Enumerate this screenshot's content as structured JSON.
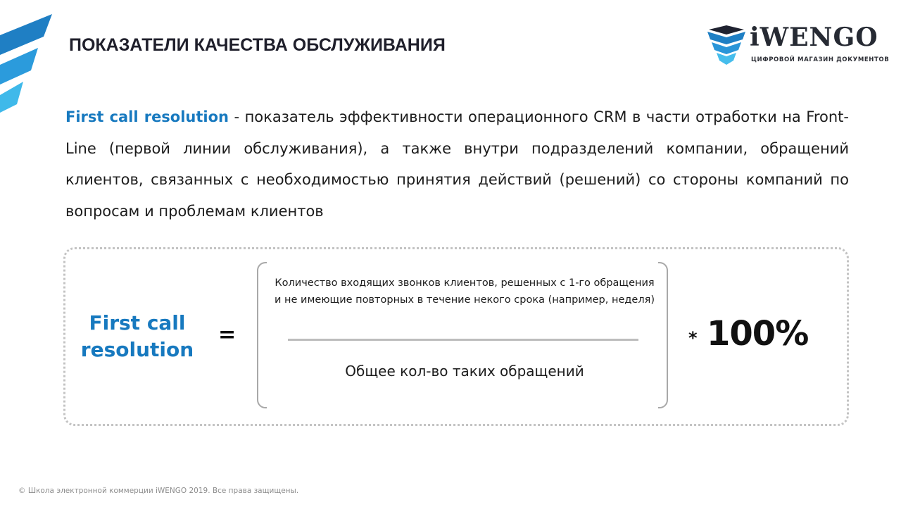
{
  "slide": {
    "title": "ПОКАЗАТЕЛИ КАЧЕСТВА ОБСЛУЖИВАНИЯ",
    "brand": {
      "wordmark": "iWENGO",
      "tagline": "ЦИФРОВОЙ МАГАЗИН ДОКУМЕНТОВ",
      "colors": {
        "primary": "#1779bf",
        "light": "#3fb6ea",
        "mid": "#2a95d8",
        "dark": "#1f2230"
      }
    },
    "intro": {
      "term": "First call resolution",
      "text": " - показатель эффективности операционного CRM в части отработки на Front-Line (первой линии обслуживания), а также внутри подразделений компании, обращений клиентов, связанных с необходимостью принятия действий (решений) со стороны компаний по вопросам и проблемам клиентов"
    },
    "formula": {
      "lhs": "First call resolution",
      "equals": "=",
      "numerator": "Количество входящих звонков клиентов, решенных с 1-го обращения и не имеющие повторных в течение некого срока (например, неделя)",
      "denominator": "Общее кол-во таких обращений",
      "multiply": "*",
      "factor": "100%"
    },
    "footer": "© Школа электронной коммерции iWENGO 2019.  Все права защищены."
  }
}
